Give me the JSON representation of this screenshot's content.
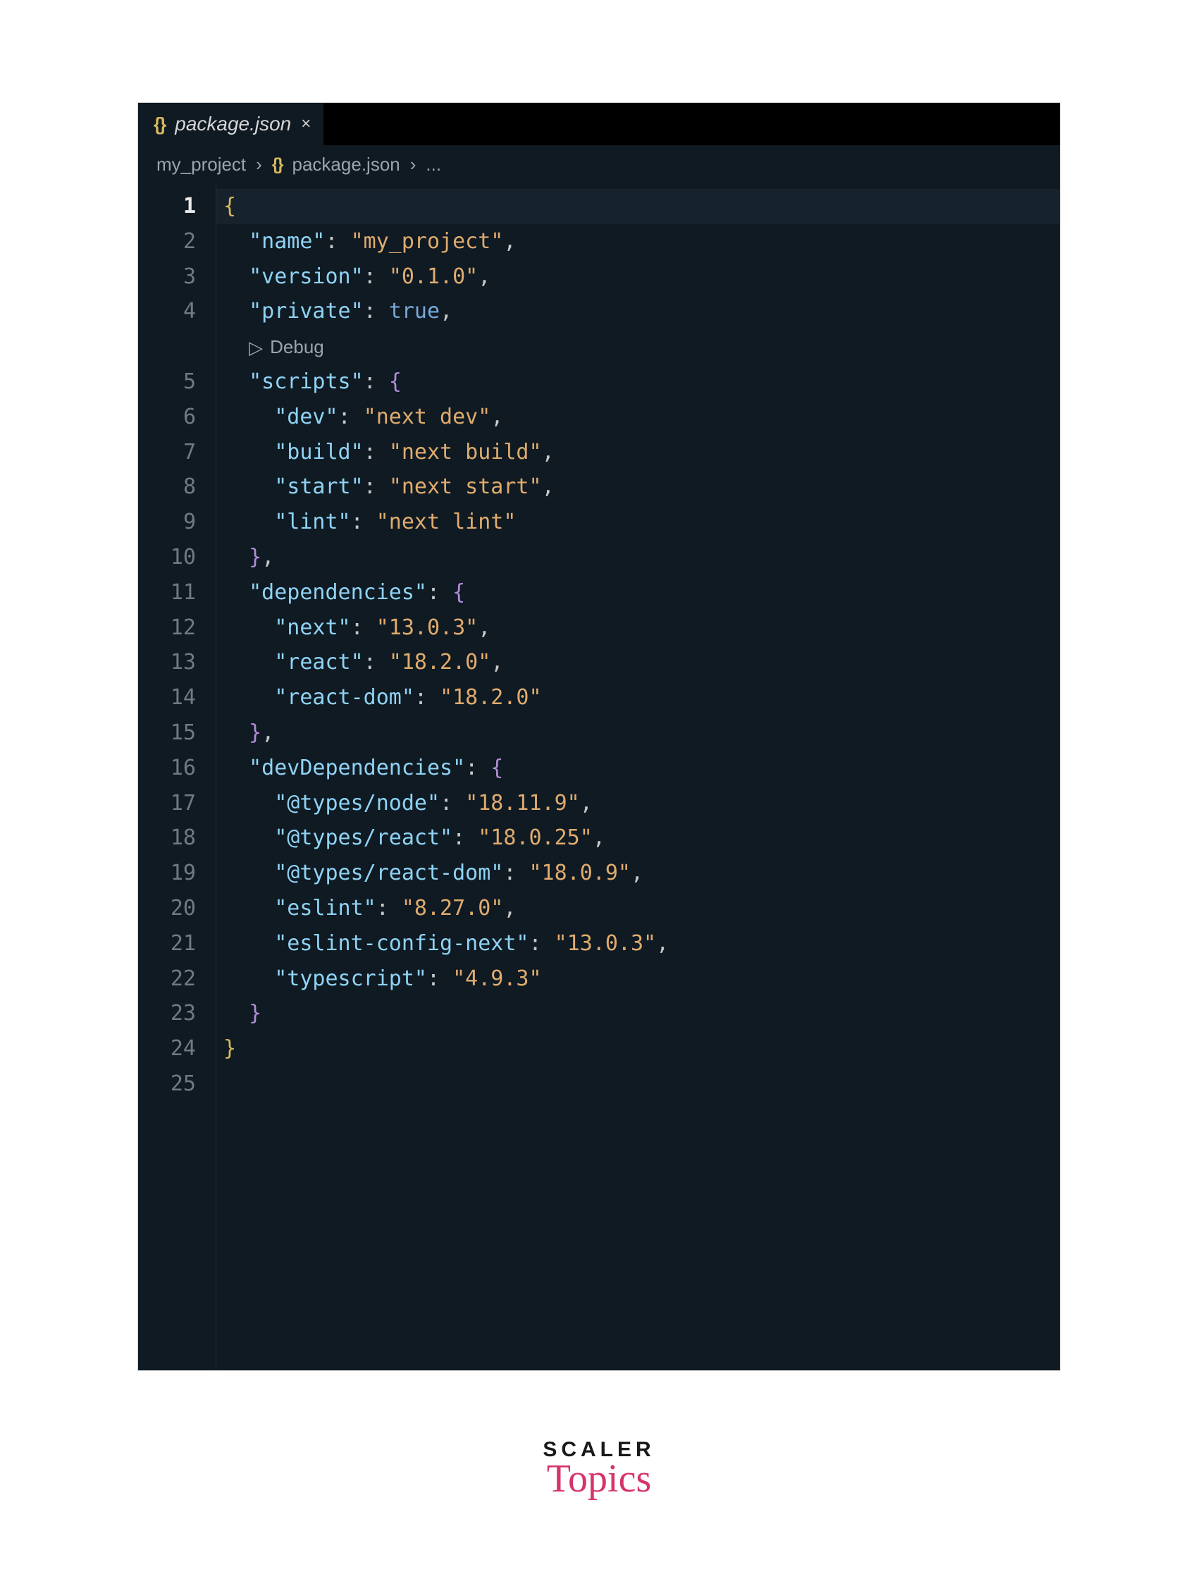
{
  "tab": {
    "icon_glyph": "{}",
    "label": "package.json",
    "close_glyph": "×"
  },
  "breadcrumb": {
    "segment1": "my_project",
    "chev": "›",
    "icon_glyph": "{}",
    "segment2": "package.json",
    "chev2": "›",
    "ellipsis": "..."
  },
  "codelens": {
    "triangle": "▷",
    "label": "Debug"
  },
  "logo": {
    "line1": "SCALER",
    "line2": "Topics"
  },
  "line_numbers": [
    "1",
    "2",
    "3",
    "4",
    "",
    "5",
    "6",
    "7",
    "8",
    "9",
    "10",
    "11",
    "12",
    "13",
    "14",
    "15",
    "16",
    "17",
    "18",
    "19",
    "20",
    "21",
    "22",
    "23",
    "24",
    "25"
  ],
  "json_file": {
    "name": "my_project",
    "version": "0.1.0",
    "private": true,
    "scripts": {
      "dev": "next dev",
      "build": "next build",
      "start": "next start",
      "lint": "next lint"
    },
    "dependencies": {
      "next": "13.0.3",
      "react": "18.2.0",
      "react-dom": "18.2.0"
    },
    "devDependencies": {
      "@types/node": "18.11.9",
      "@types/react": "18.0.25",
      "@types/react-dom": "18.0.9",
      "eslint": "8.27.0",
      "eslint-config-next": "13.0.3",
      "typescript": "4.9.3"
    }
  },
  "code_lines": [
    {
      "indent": 0,
      "type": "brace",
      "text": "{",
      "hl": true
    },
    {
      "indent": 1,
      "type": "kv_str",
      "key": "name",
      "value": "my_project",
      "comma": true
    },
    {
      "indent": 1,
      "type": "kv_str",
      "key": "version",
      "value": "0.1.0",
      "comma": true
    },
    {
      "indent": 1,
      "type": "kv_bool",
      "key": "private",
      "value": "true",
      "comma": true
    },
    {
      "indent": 1,
      "type": "codelens"
    },
    {
      "indent": 1,
      "type": "kv_open",
      "key": "scripts"
    },
    {
      "indent": 2,
      "type": "kv_str",
      "key": "dev",
      "value": "next dev",
      "comma": true
    },
    {
      "indent": 2,
      "type": "kv_str",
      "key": "build",
      "value": "next build",
      "comma": true
    },
    {
      "indent": 2,
      "type": "kv_str",
      "key": "start",
      "value": "next start",
      "comma": true
    },
    {
      "indent": 2,
      "type": "kv_str",
      "key": "lint",
      "value": "next lint",
      "comma": false
    },
    {
      "indent": 1,
      "type": "close_inner",
      "comma": true
    },
    {
      "indent": 1,
      "type": "kv_open",
      "key": "dependencies"
    },
    {
      "indent": 2,
      "type": "kv_str",
      "key": "next",
      "value": "13.0.3",
      "comma": true
    },
    {
      "indent": 2,
      "type": "kv_str",
      "key": "react",
      "value": "18.2.0",
      "comma": true
    },
    {
      "indent": 2,
      "type": "kv_str",
      "key": "react-dom",
      "value": "18.2.0",
      "comma": false
    },
    {
      "indent": 1,
      "type": "close_inner",
      "comma": true
    },
    {
      "indent": 1,
      "type": "kv_open",
      "key": "devDependencies"
    },
    {
      "indent": 2,
      "type": "kv_str",
      "key": "@types/node",
      "value": "18.11.9",
      "comma": true
    },
    {
      "indent": 2,
      "type": "kv_str",
      "key": "@types/react",
      "value": "18.0.25",
      "comma": true
    },
    {
      "indent": 2,
      "type": "kv_str",
      "key": "@types/react-dom",
      "value": "18.0.9",
      "comma": true
    },
    {
      "indent": 2,
      "type": "kv_str",
      "key": "eslint",
      "value": "8.27.0",
      "comma": true
    },
    {
      "indent": 2,
      "type": "kv_str",
      "key": "eslint-config-next",
      "value": "13.0.3",
      "comma": true
    },
    {
      "indent": 2,
      "type": "kv_str",
      "key": "typescript",
      "value": "4.9.3",
      "comma": false
    },
    {
      "indent": 1,
      "type": "close_inner",
      "comma": false
    },
    {
      "indent": 0,
      "type": "brace",
      "text": "}"
    },
    {
      "indent": 0,
      "type": "empty"
    }
  ]
}
